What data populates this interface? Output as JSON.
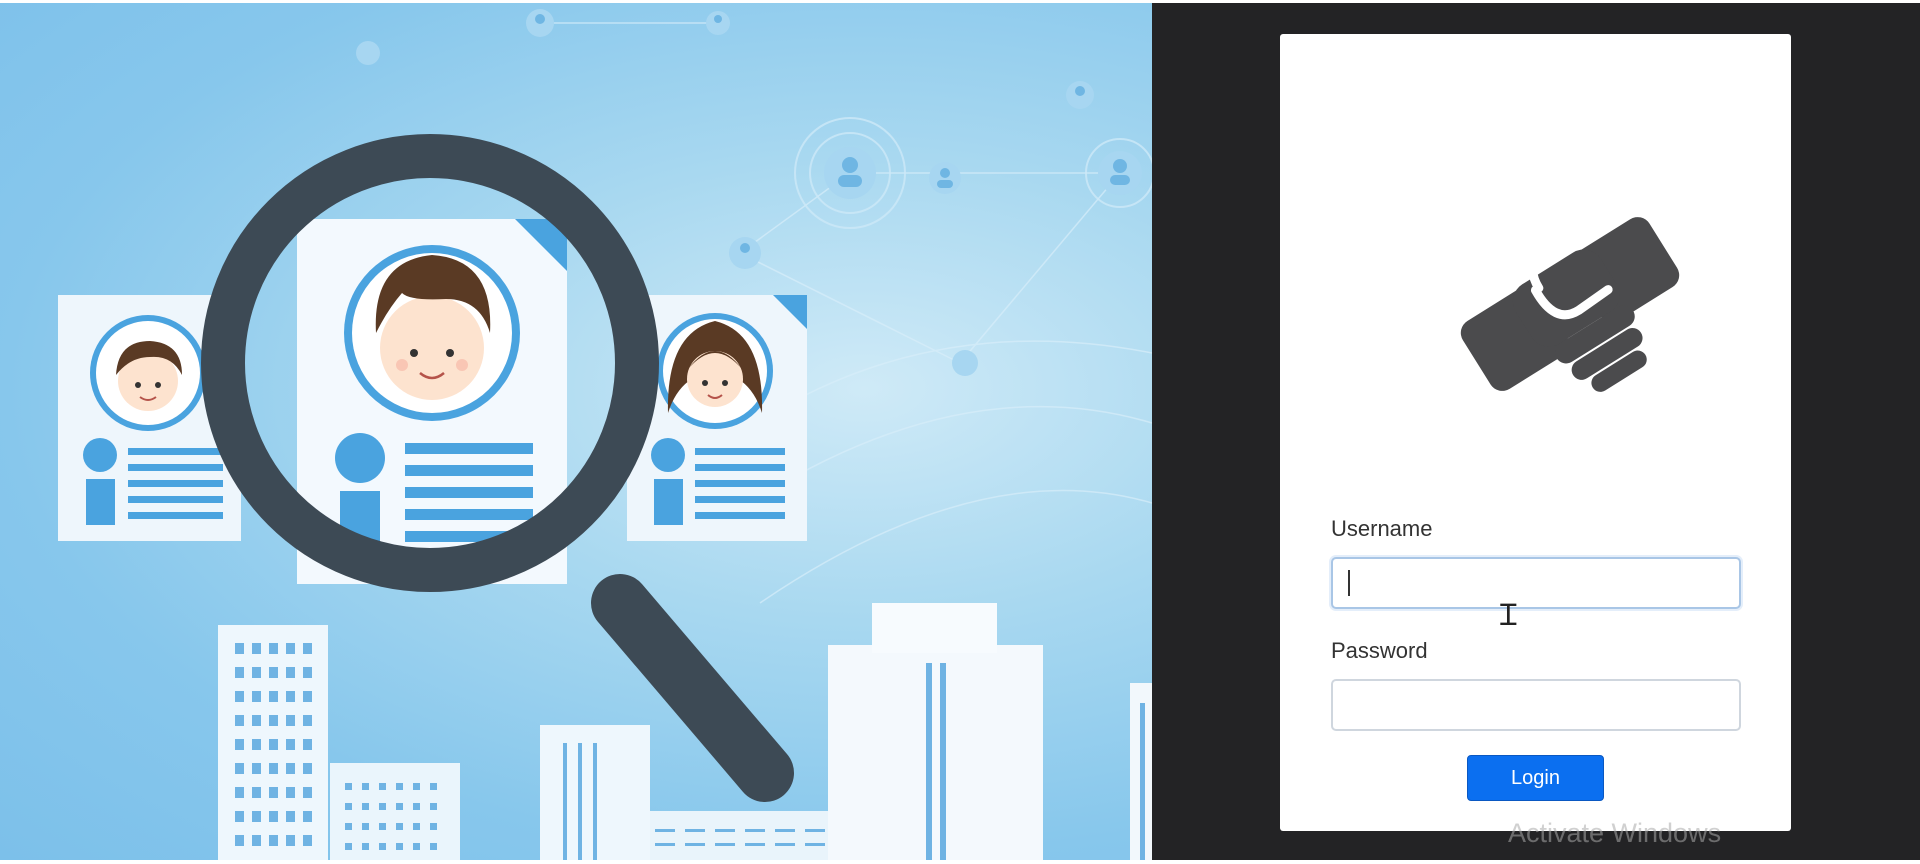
{
  "hero": {
    "illustration": "recruitment-search-illustration"
  },
  "login": {
    "logo": "handshake-icon",
    "username_label": "Username",
    "username_value": "",
    "password_label": "Password",
    "password_value": "",
    "login_button": "Login"
  },
  "watermark": {
    "title": "Activate Windows"
  },
  "colors": {
    "primary_button": "#0b6ff0",
    "dark_panel": "#232325",
    "hero_sky": "#8ccaee",
    "illustration_dark": "#3d4a55",
    "illustration_blue": "#4aa3df"
  }
}
